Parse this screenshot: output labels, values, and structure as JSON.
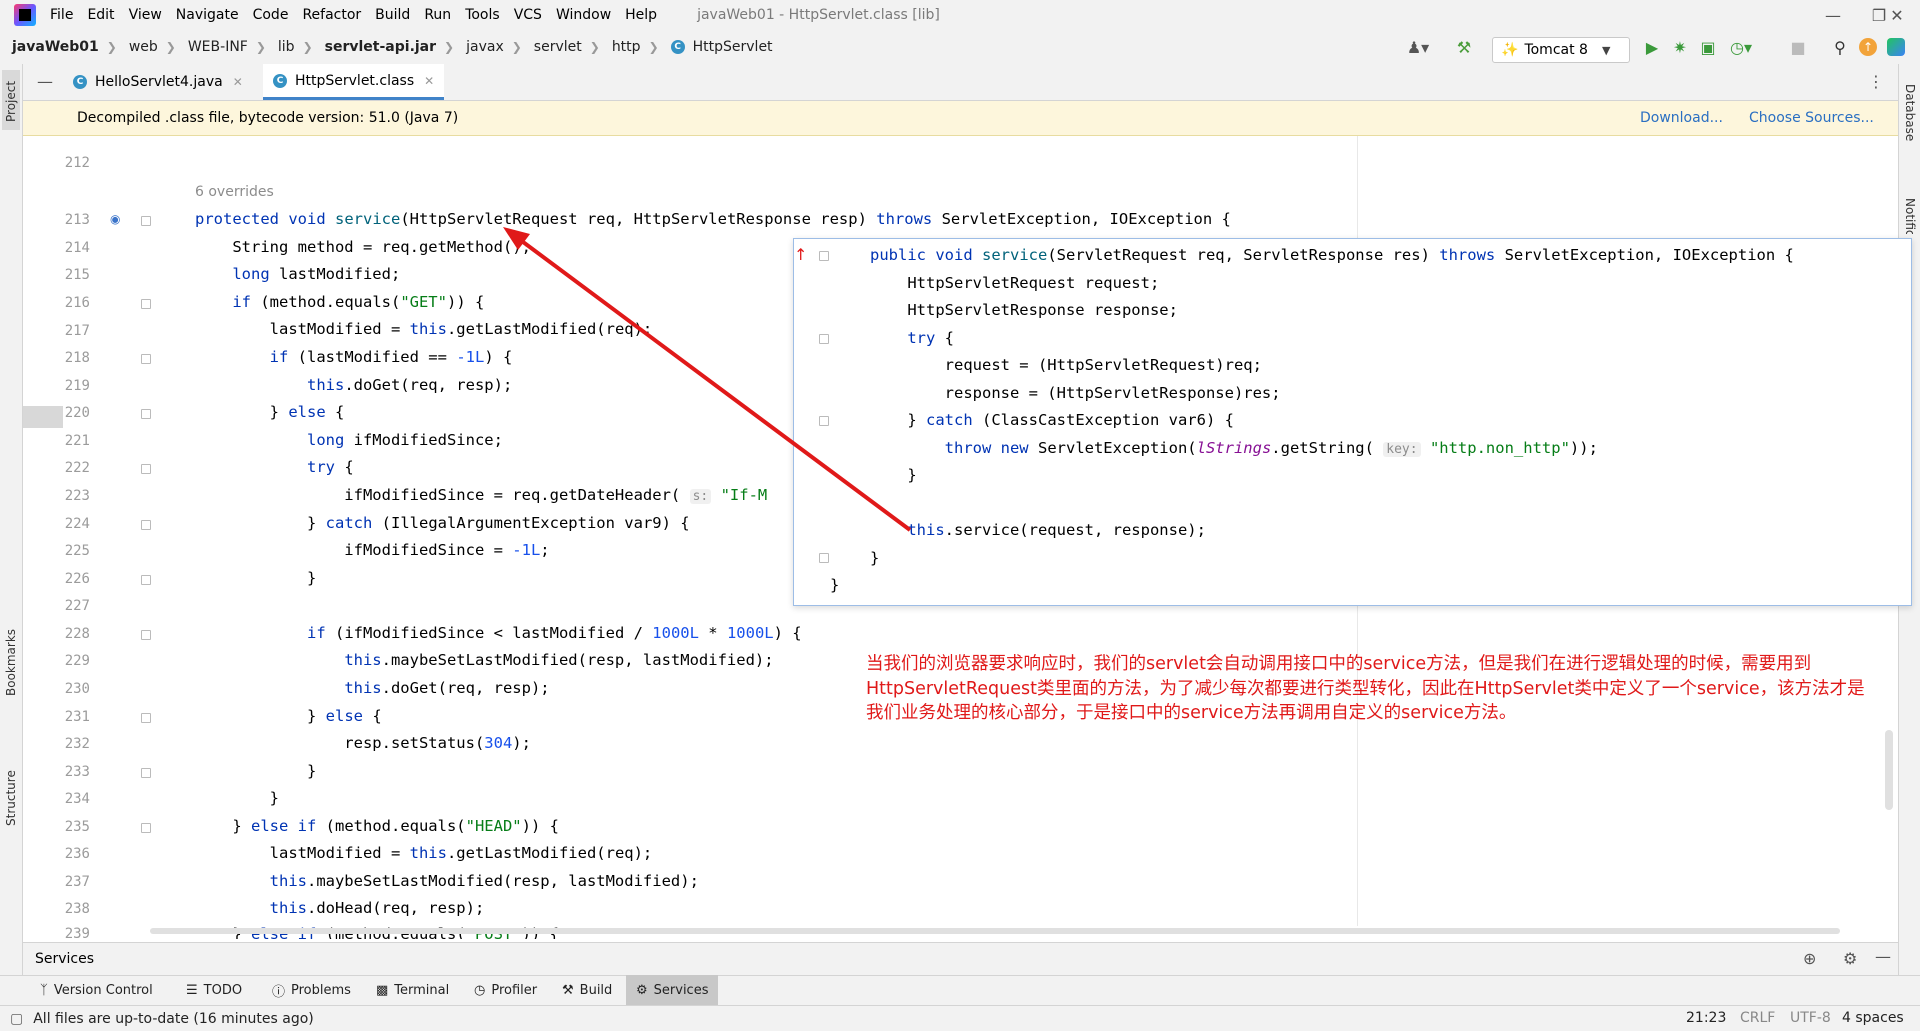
{
  "menubar": {
    "items": [
      "File",
      "Edit",
      "View",
      "Navigate",
      "Code",
      "Refactor",
      "Build",
      "Run",
      "Tools",
      "VCS",
      "Window",
      "Help"
    ],
    "window_title": "javaWeb01 - HttpServlet.class [lib]"
  },
  "breadcrumb": [
    "javaWeb01",
    "web",
    "WEB-INF",
    "lib",
    "servlet-api.jar",
    "javax",
    "servlet",
    "http",
    "HttpServlet"
  ],
  "toolbar": {
    "run_config": "Tomcat 8"
  },
  "tabs": [
    {
      "label": "HelloServlet4.java",
      "active": false
    },
    {
      "label": "HttpServlet.class",
      "active": true
    }
  ],
  "banner": {
    "message": "Decompiled .class file, bytecode version: 51.0 (Java 7)",
    "download": "Download...",
    "choose_sources": "Choose Sources..."
  },
  "side_tools": {
    "project": "Project",
    "bookmarks": "Bookmarks",
    "structure": "Structure",
    "database": "Database",
    "notifications": "Notifications"
  },
  "editor": {
    "overrides_hint": "6 overrides",
    "line_numbers": [
      "212",
      "213",
      "214",
      "215",
      "216",
      "217",
      "218",
      "219",
      "220",
      "221",
      "222",
      "223",
      "224",
      "225",
      "226",
      "227",
      "228",
      "229",
      "230",
      "231",
      "232",
      "233",
      "234",
      "235",
      "236",
      "237",
      "238",
      "239"
    ]
  },
  "popup_hint": "key:",
  "string_hint_s": "s:",
  "annotation": "当我们的浏览器要求响应时，我们的servlet会自动调用接口中的service方法，但是我们在进行逻辑处理的时候，需要用到HttpServletRequest类里面的方法，为了减少每次都要进行类型转化，因此在HttpServlet类中定义了一个service，该方法才是我们业务处理的核心部分，于是接口中的service方法再调用自定义的service方法。",
  "services": {
    "label": "Services"
  },
  "tool_windows": [
    "Version Control",
    "TODO",
    "Problems",
    "Terminal",
    "Profiler",
    "Build",
    "Services"
  ],
  "status": {
    "message": "All files are up-to-date (16 minutes ago)",
    "position": "21:23",
    "line_sep": "CRLF",
    "encoding": "UTF-8",
    "indent": "4 spaces"
  },
  "colors": {
    "accent": "#4083c9",
    "keyword": "#0033b3",
    "string": "#067d17",
    "number": "#1750eb",
    "annotation": "#e01919",
    "arrow": "#e01919"
  }
}
